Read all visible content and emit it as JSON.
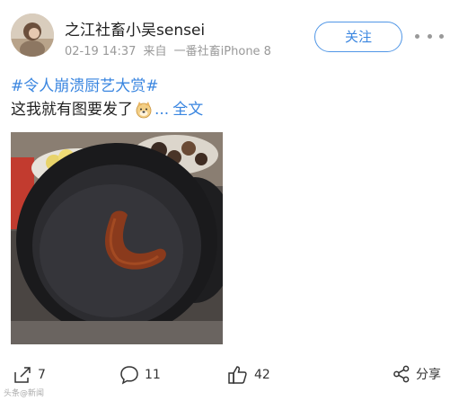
{
  "post": {
    "author": "之江社畜小吴sensei",
    "timestamp": "02-19 14:37",
    "source_prefix": "来自",
    "source": "一番社畜iPhone 8",
    "follow_label": "关注",
    "topic": "#令人崩溃厨艺大赏#",
    "text": "这我就有图要发了",
    "emoji": "doge-emoji",
    "ellipsis": "...",
    "expand_label": "全文"
  },
  "actions": {
    "repost_count": "7",
    "comment_count": "11",
    "like_count": "42",
    "share_label": "分享"
  },
  "watermark": "头条@新闻",
  "colors": {
    "link": "#3a86e0",
    "meta": "#999999"
  }
}
